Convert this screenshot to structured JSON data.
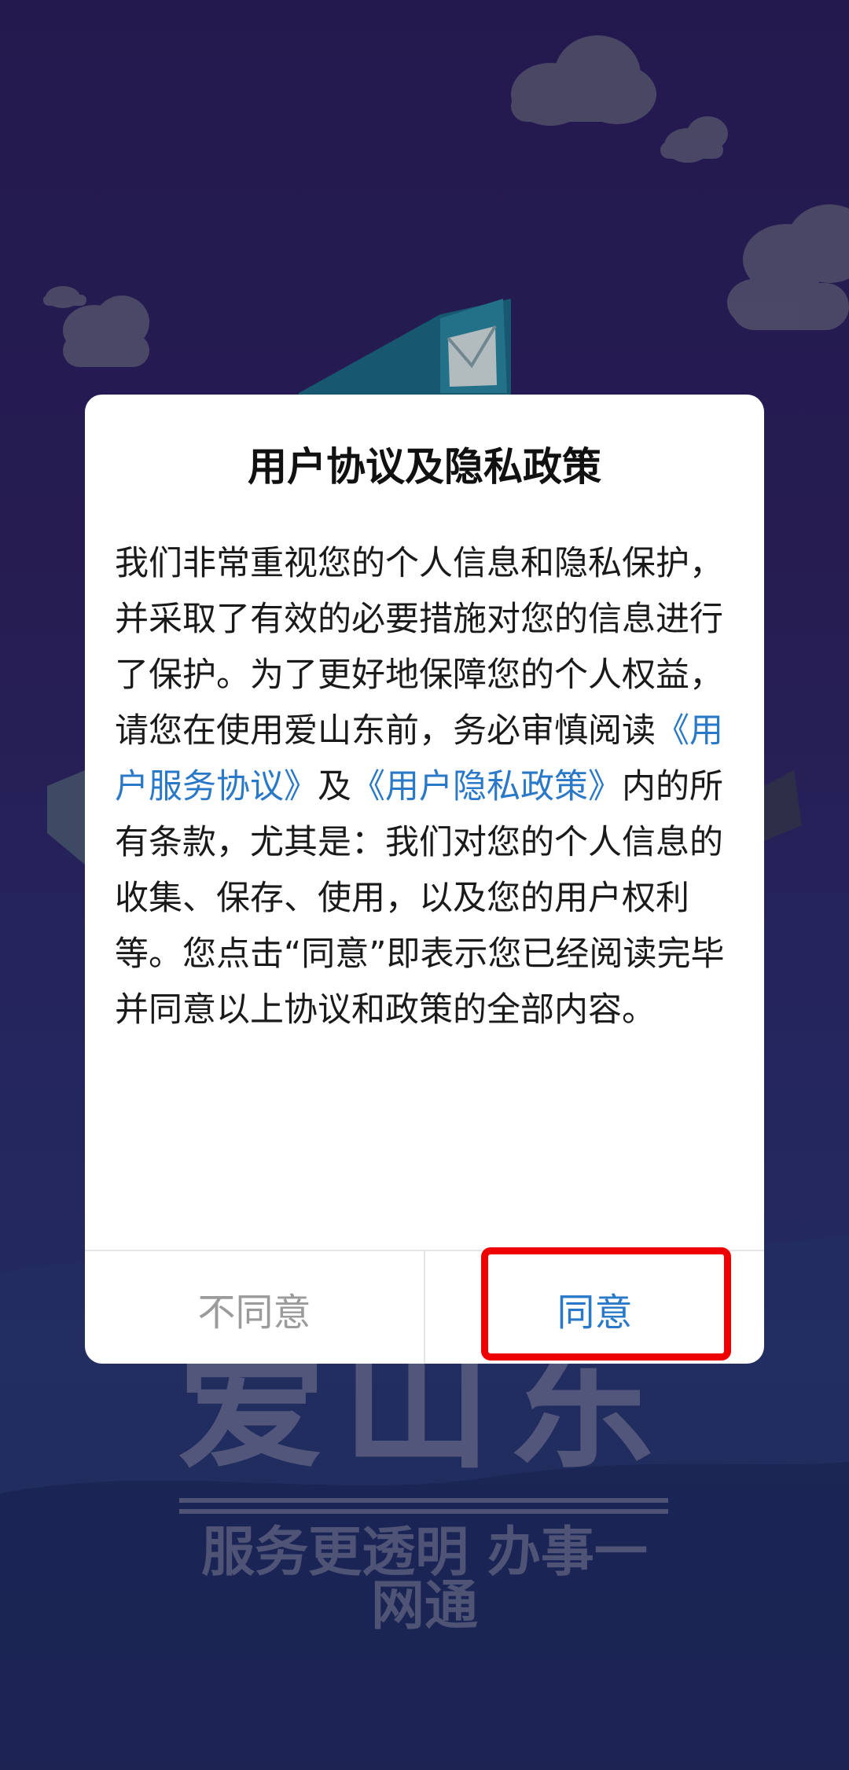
{
  "splash": {
    "brand_name": "爱山东",
    "slogan": "服务更透明 办事一网通"
  },
  "dialog": {
    "title": "用户协议及隐私政策",
    "body": {
      "part1": "我们非常重视您的个人信息和隐私保护，并采取了有效的必要措施对您的信息进行了保护。为了更好地保障您的个人权益，请您在使用爱山东前，务必审慎阅读",
      "link_service": "《用户服务协议》",
      "part2": "及",
      "link_privacy": "《用户隐私政策》",
      "part3": "内的所有条款，尤其是：我们对您的个人信息的收集、保存、使用，以及您的用户权利等。您点击“同意”即表示您已经阅读完毕并同意以上协议和政策的全部内容。"
    },
    "buttons": {
      "disagree": "不同意",
      "agree": "同意"
    }
  },
  "colors": {
    "link": "#2a78c8",
    "highlight": "#ef0000",
    "background_top": "#2c1f60"
  },
  "icons": [
    "cloud-icon",
    "envelope-icon"
  ]
}
